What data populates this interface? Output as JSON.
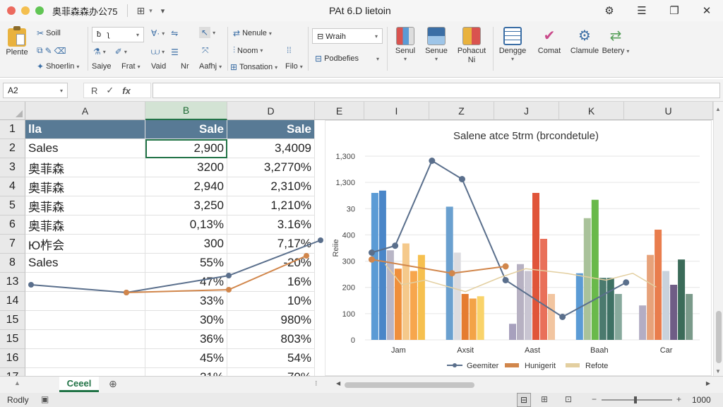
{
  "window": {
    "app_title": "奥菲森森办公75",
    "doc_title": "PAt 6.D lietoin"
  },
  "ribbon": {
    "paste_label": "Plente",
    "cut_label": "Soill",
    "copy_label": "Shoerlin",
    "font_box": "",
    "style_label": "Saiye",
    "format_label": "Frat",
    "view_label": "Vaid",
    "nr_label": "Nr",
    "arrange_label": "Aafhj",
    "rename_label": "Nenule",
    "noon_label": "Noom",
    "transaction_label": "Tonsation",
    "filo_label": "Filo",
    "wrap_label": "Wraih",
    "properties_label": "Podbefies",
    "send_label": "Senul",
    "same_label": "Senue",
    "pohacut_label": "Pohacut",
    "pohacut_sub": "Ni",
    "design_label": "Dengge",
    "comat_label": "Comat",
    "clamule_label": "Clamule",
    "betery_label": "Betery"
  },
  "formula_bar": {
    "name_box": "A2",
    "cancel_glyph": "R",
    "confirm_glyph": "✓",
    "fx_glyph": "fx",
    "formula_value": ""
  },
  "sheet": {
    "columns": [
      "A",
      "B",
      "D",
      "E",
      "I",
      "Z",
      "J",
      "K",
      "U"
    ],
    "rows": [
      {
        "num": "1",
        "a": "lla",
        "b": "Sale",
        "d": "Sale",
        "header": true
      },
      {
        "num": "2",
        "a": "Sales",
        "b": "2,900",
        "d": "3,4009"
      },
      {
        "num": "3",
        "a": "奥菲森",
        "b": "3200",
        "d": "3,2770%"
      },
      {
        "num": "4",
        "a": "奥菲森",
        "b": "2,940",
        "d": "2,310%"
      },
      {
        "num": "5",
        "a": "奥菲森",
        "b": "3,250",
        "d": "1,210%"
      },
      {
        "num": "6",
        "a": "奥菲森",
        "b": "0,13%",
        "d": "3.16%"
      },
      {
        "num": "7",
        "a": "Ю柞会",
        "b": "300",
        "d": "7,17%"
      },
      {
        "num": "8",
        "a": "Sales",
        "b": "55%",
        "d": "-20%"
      },
      {
        "num": "13",
        "a": "",
        "b": "47%",
        "d": "16%"
      },
      {
        "num": "14",
        "a": "",
        "b": "33%",
        "d": "10%"
      },
      {
        "num": "15",
        "a": "",
        "b": "30%",
        "d": "980%"
      },
      {
        "num": "15",
        "a": "",
        "b": "36%",
        "d": "803%"
      },
      {
        "num": "16",
        "a": "",
        "b": "45%",
        "d": "54%"
      },
      {
        "num": "17",
        "a": "",
        "b": "21%",
        "d": "70%"
      }
    ],
    "selected_cell": "B2",
    "sheet_tab": "Ceeel"
  },
  "status": {
    "ready": "Rodly",
    "zoom": "1000"
  },
  "colors": {
    "accent": "#217346",
    "header_fill": "#587a95"
  },
  "chart_data": {
    "type": "bar",
    "title": "Salene atce 5trm (brcondetule)",
    "ylabel": "Reiie",
    "yticks": [
      "0",
      "100",
      "200",
      "300",
      "400",
      "30",
      "1,300",
      "1,300"
    ],
    "categories": [
      "Jam",
      "Axsit",
      "Aast",
      "Baah",
      "Car"
    ],
    "legend": [
      "Geemiter",
      "Hunigerit",
      "Refote"
    ],
    "bars": [
      [
        {
          "v": 640,
          "c": "#5b9bd5"
        },
        {
          "v": 650,
          "c": "#4a86c8"
        },
        {
          "v": 390,
          "c": "#b9b6c6"
        },
        {
          "v": 310,
          "c": "#ef8f3c"
        },
        {
          "v": 420,
          "c": "#f5c98b"
        },
        {
          "v": 300,
          "c": "#f7a64d"
        },
        {
          "v": 370,
          "c": "#f6c04f"
        }
      ],
      [
        {
          "v": 580,
          "c": "#6aa0cf"
        },
        {
          "v": 380,
          "c": "#dcdce0"
        },
        {
          "v": 200,
          "c": "#e57c30"
        },
        {
          "v": 180,
          "c": "#f3a347"
        },
        {
          "v": 190,
          "c": "#f9d36a"
        }
      ],
      [
        {
          "v": 70,
          "c": "#a7a0bd"
        },
        {
          "v": 330,
          "c": "#b7b1c2"
        },
        {
          "v": 300,
          "c": "#c9c5d2"
        },
        {
          "v": 640,
          "c": "#e0553a"
        },
        {
          "v": 440,
          "c": "#e9705a"
        },
        {
          "v": 200,
          "c": "#f2c5a0"
        }
      ],
      [
        {
          "v": 290,
          "c": "#5b9bd5"
        },
        {
          "v": 530,
          "c": "#a9c29a"
        },
        {
          "v": 610,
          "c": "#69b94a"
        },
        {
          "v": 270,
          "c": "#4b7a6e"
        },
        {
          "v": 270,
          "c": "#3e7164"
        },
        {
          "v": 200,
          "c": "#87a99c"
        }
      ],
      [
        {
          "v": 150,
          "c": "#b3adc4"
        },
        {
          "v": 370,
          "c": "#e7a27a"
        },
        {
          "v": 480,
          "c": "#e97d4d"
        },
        {
          "v": 300,
          "c": "#c9d2dc"
        },
        {
          "v": 240,
          "c": "#6f5d86"
        },
        {
          "v": 350,
          "c": "#3b6b59"
        },
        {
          "v": 200,
          "c": "#7a9a8a"
        }
      ]
    ],
    "line_series": [
      {
        "name": "Geemiter",
        "color": "#5a6f8c",
        "points": [
          [
            0.0,
            380
          ],
          [
            0.35,
            410
          ],
          [
            0.9,
            780
          ],
          [
            1.35,
            700
          ],
          [
            2.0,
            260
          ],
          [
            2.85,
            100
          ],
          [
            3.8,
            250
          ]
        ]
      },
      {
        "name": "Hunigerit",
        "color": "#d1864b",
        "points": [
          [
            0.0,
            350
          ],
          [
            1.2,
            290
          ],
          [
            2.0,
            320
          ]
        ]
      },
      {
        "name": "Refote",
        "color": "#e3cfa0",
        "points": [
          [
            0.2,
            330
          ],
          [
            0.45,
            240
          ],
          [
            0.8,
            260
          ],
          [
            1.4,
            210
          ],
          [
            1.9,
            270
          ],
          [
            2.3,
            310
          ],
          [
            2.9,
            290
          ],
          [
            3.5,
            260
          ],
          [
            3.9,
            290
          ],
          [
            4.25,
            230
          ]
        ]
      }
    ],
    "grid": true,
    "legend_position": "bottom"
  },
  "sheet_line_series": [
    {
      "color": "#5a6f8c",
      "points": [
        [
          0,
          403
        ],
        [
          135,
          414
        ],
        [
          280,
          390
        ],
        [
          410,
          340
        ]
      ]
    },
    {
      "color": "#d1864b",
      "points": [
        [
          135,
          414
        ],
        [
          280,
          410
        ],
        [
          390,
          362
        ]
      ]
    }
  ]
}
